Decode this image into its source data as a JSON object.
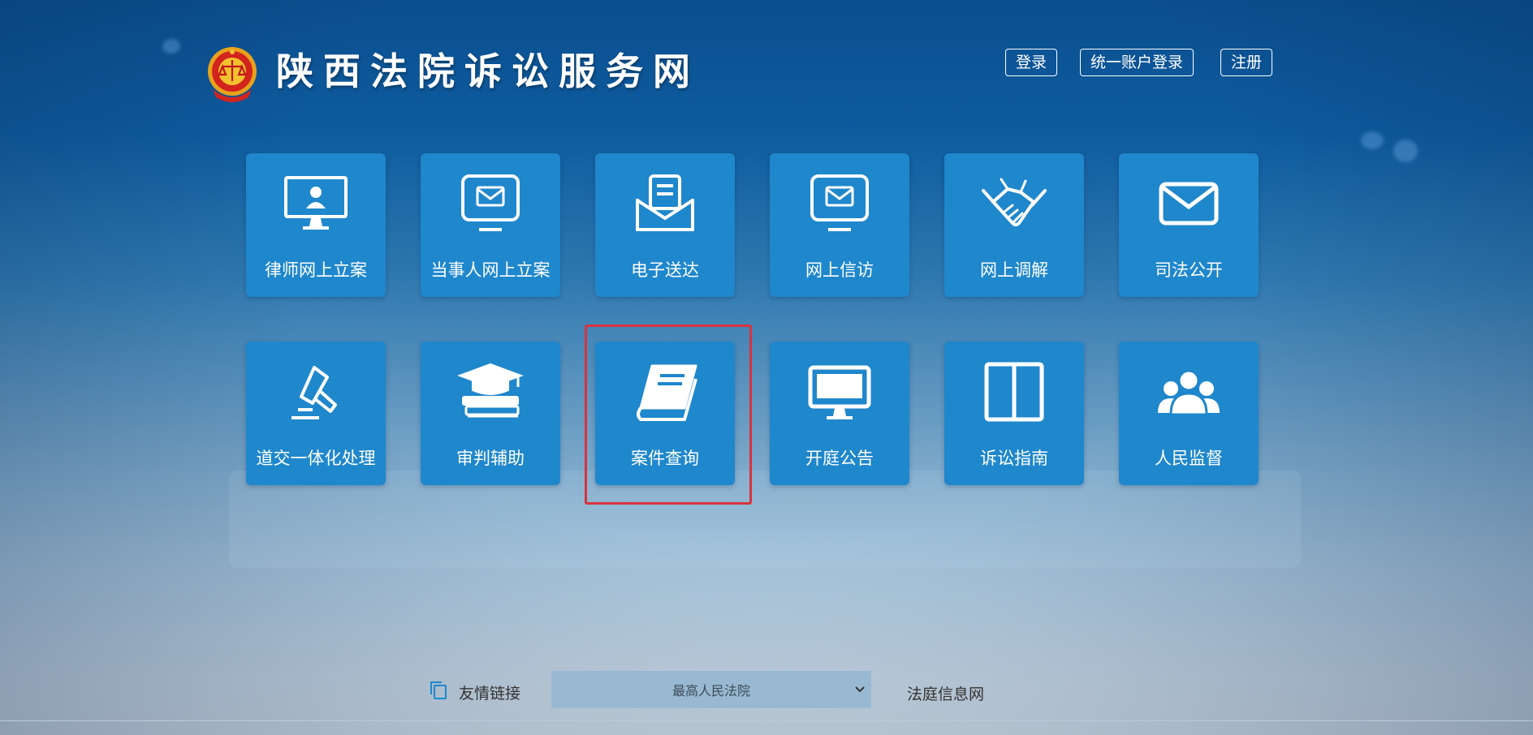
{
  "header": {
    "logo_icon": "court-emblem-icon",
    "title": "陕西法院诉讼服务网",
    "buttons": [
      {
        "label": "登录"
      },
      {
        "label": "统一账户登录"
      },
      {
        "label": "注册"
      }
    ]
  },
  "tiles": [
    {
      "label": "律师网上立案",
      "icon": "monitor-user-icon"
    },
    {
      "label": "当事人网上立案",
      "icon": "monitor-mail-icon"
    },
    {
      "label": "电子送达",
      "icon": "envelope-document-icon"
    },
    {
      "label": "网上信访",
      "icon": "monitor-mail-icon"
    },
    {
      "label": "网上调解",
      "icon": "handshake-icon"
    },
    {
      "label": "司法公开",
      "icon": "mail-icon"
    },
    {
      "label": "道交一体化处理",
      "icon": "gavel-icon"
    },
    {
      "label": "审判辅助",
      "icon": "graduation-books-icon"
    },
    {
      "label": "案件查询",
      "icon": "book-icon",
      "highlighted": true
    },
    {
      "label": "开庭公告",
      "icon": "monitor-icon"
    },
    {
      "label": "诉讼指南",
      "icon": "split-panel-icon"
    },
    {
      "label": "人民监督",
      "icon": "people-group-icon"
    }
  ],
  "footer": {
    "links_icon": "copy-icon",
    "links_label": "友情链接",
    "select_value": "最高人民法院",
    "info_link": "法庭信息网"
  },
  "colors": {
    "tile": "#1f87cc",
    "highlight": "#d8333e"
  }
}
